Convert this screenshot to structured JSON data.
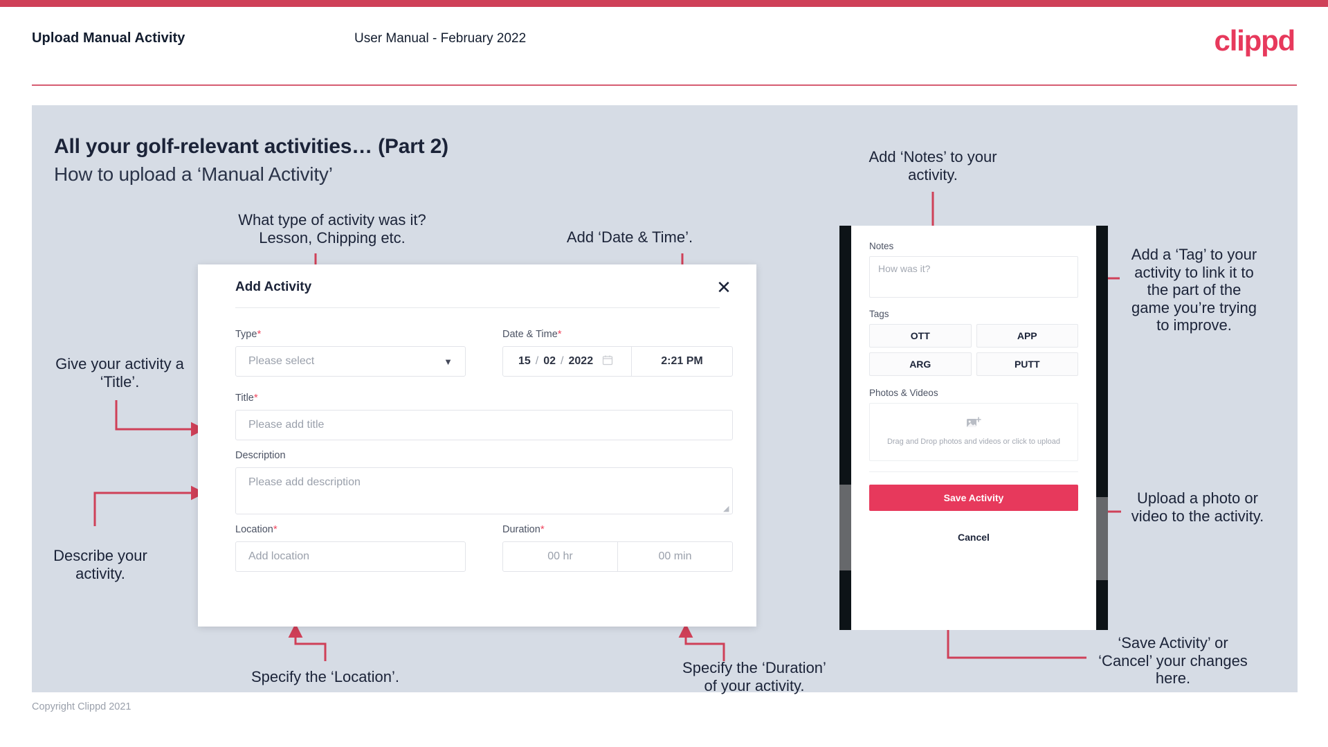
{
  "header": {
    "title": "Upload Manual Activity",
    "subtitle": "User Manual - February 2022",
    "logo": "clippd"
  },
  "slide": {
    "title": "All your golf-relevant activities… (Part 2)",
    "subtitle": "How to upload a ‘Manual Activity’"
  },
  "annotations": {
    "type": "What type of activity was it?\nLesson, Chipping etc.",
    "datetime": "Add ‘Date & Time’.",
    "title": "Give your activity a\n‘Title’.",
    "description": "Describe your\nactivity.",
    "location": "Specify the ‘Location’.",
    "duration": "Specify the ‘Duration’\nof your activity.",
    "notes": "Add ‘Notes’ to your\nactivity.",
    "tags": "Add a ‘Tag’ to your\nactivity to link it to\nthe part of the\ngame you’re trying\nto improve.",
    "upload": "Upload a photo or\nvideo to the activity.",
    "save": "‘Save Activity’ or\n‘Cancel’ your changes\nhere."
  },
  "dialog": {
    "title": "Add Activity",
    "close_icon": "close-icon",
    "fields": {
      "type": {
        "label": "Type",
        "required": "*",
        "placeholder": "Please select",
        "caret_icon": "chevron-down-icon"
      },
      "datetime": {
        "label": "Date & Time",
        "required": "*",
        "day": "15",
        "month": "02",
        "year": "2022",
        "sep": "/",
        "time": "2:21 PM",
        "calendar_icon": "calendar-icon"
      },
      "title": {
        "label": "Title",
        "required": "*",
        "placeholder": "Please add title"
      },
      "description": {
        "label": "Description",
        "required": "",
        "placeholder": "Please add description"
      },
      "location": {
        "label": "Location",
        "required": "*",
        "placeholder": "Add location"
      },
      "duration": {
        "label": "Duration",
        "required": "*",
        "hours_placeholder": "00 hr",
        "minutes_placeholder": "00 min"
      }
    }
  },
  "phone": {
    "notes": {
      "label": "Notes",
      "placeholder": "How was it?"
    },
    "tags": {
      "label": "Tags",
      "items": [
        "OTT",
        "APP",
        "ARG",
        "PUTT"
      ]
    },
    "photos": {
      "label": "Photos & Videos",
      "icon": "add-image-icon",
      "dropzone_text": "Drag and Drop photos and videos or click to upload"
    },
    "save_label": "Save Activity",
    "cancel_label": "Cancel"
  },
  "footer": {
    "copyright": "Copyright Clippd 2021"
  },
  "colors": {
    "accent": "#cf4058",
    "brand": "#e7395c",
    "slide_bg": "#d6dce5",
    "text_dark": "#1b2338",
    "connector": "#cf4058"
  }
}
